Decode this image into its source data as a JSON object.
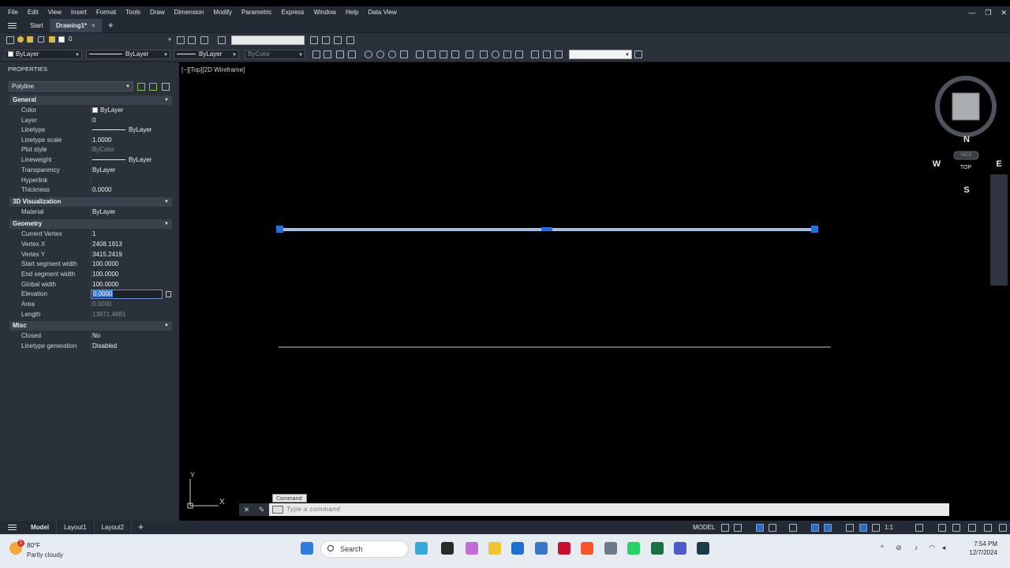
{
  "menubar": {
    "items": [
      "File",
      "Edit",
      "View",
      "Insert",
      "Format",
      "Tools",
      "Draw",
      "Dimension",
      "Modify",
      "Parametric",
      "Express",
      "Window",
      "Help",
      "Data View"
    ]
  },
  "tabs": {
    "start": "Start",
    "drawing": "Drawing1*",
    "close_glyph": "×",
    "new_glyph": "+"
  },
  "toolbar": {
    "layer_value": "0",
    "color_value": "ByLayer",
    "linetype_value": "ByLayer",
    "lineweight_value": "ByLayer",
    "plotstyle_value": "ByColor"
  },
  "properties": {
    "title": "PROPERTIES",
    "object_type": "Polyline",
    "sections": {
      "general": "General",
      "viz": "3D Visualization",
      "geometry": "Geometry",
      "misc": "Misc"
    },
    "general": [
      {
        "label": "Color",
        "value": "ByLayer"
      },
      {
        "label": "Layer",
        "value": "0"
      },
      {
        "label": "Linetype",
        "value": "ByLayer"
      },
      {
        "label": "Linetype scale",
        "value": "1.0000"
      },
      {
        "label": "Plot style",
        "value": "ByColor"
      },
      {
        "label": "Lineweight",
        "value": "ByLayer"
      },
      {
        "label": "Transparency",
        "value": "ByLayer"
      },
      {
        "label": "Hyperlink",
        "value": ""
      },
      {
        "label": "Thickness",
        "value": "0.0000"
      }
    ],
    "viz": [
      {
        "label": "Material",
        "value": "ByLayer"
      }
    ],
    "geometry": [
      {
        "label": "Current Vertex",
        "value": "1"
      },
      {
        "label": "Vertex X",
        "value": "2408.1913"
      },
      {
        "label": "Vertex Y",
        "value": "3415.2419"
      },
      {
        "label": "Start segment width",
        "value": "100.0000"
      },
      {
        "label": "End segment width",
        "value": "100.0000"
      },
      {
        "label": "Global width",
        "value": "100.0000"
      },
      {
        "label": "Elevation",
        "value": "0.0000"
      },
      {
        "label": "Area",
        "value": "0.0000"
      },
      {
        "label": "Length",
        "value": "13971.4881"
      }
    ],
    "misc": [
      {
        "label": "Closed",
        "value": "No"
      },
      {
        "label": "Linetype generation",
        "value": "Disabled"
      }
    ]
  },
  "viewport": {
    "label": "[−][Top][2D Wireframe]",
    "viewcube_face": "TOP",
    "compass": {
      "n": "N",
      "s": "S",
      "e": "E",
      "w": "W"
    },
    "wcs": "WCS",
    "ucs_y": "Y",
    "ucs_x": "X"
  },
  "command": {
    "tooltip": "Command:",
    "placeholder": "Type a command"
  },
  "status": {
    "tabs": [
      "Model",
      "Layout1",
      "Layout2"
    ],
    "model": "MODEL",
    "scale": "1:1"
  },
  "taskbar": {
    "temp": "80°F",
    "weather": "Partly cloudy",
    "weather_badge": "1",
    "search": "Search",
    "time": "7:54 PM",
    "date": "12/7/2024"
  },
  "colors": {
    "selected_polyline": "#a6bdde",
    "grip": "#2a6fd6",
    "panel_bg": "#2b313a",
    "accent": "#3875d7"
  }
}
